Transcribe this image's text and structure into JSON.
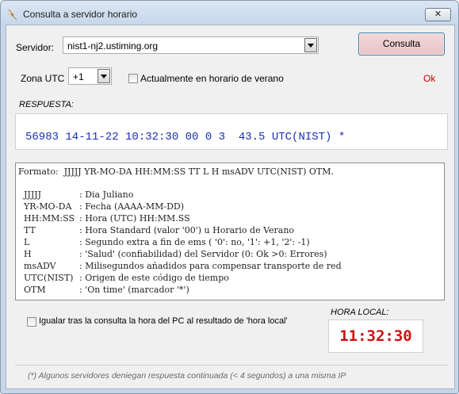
{
  "window": {
    "title": "Consulta a servidor horario",
    "close_glyph": "✕",
    "icon": "lightning-app-icon"
  },
  "server": {
    "label": "Servidor:",
    "value": "nist1-nj2.ustiming.org"
  },
  "query_button": {
    "label": "Consulta"
  },
  "zone": {
    "label": "Zona UTC",
    "value": "+1"
  },
  "summer_time": {
    "label": "Actualmente en horario de verano",
    "checked": false
  },
  "status": {
    "text": "Ok",
    "color": "#cc0000"
  },
  "response": {
    "label": "RESPUESTA:",
    "text": "56983 14-11-22 10:32:30 00 0 3  43.5 UTC(NIST) *",
    "color": "#1a2fb0"
  },
  "format": {
    "header": "Formato:  JJJJJ YR-MO-DA HH:MM:SS TT L H msADV UTC(NIST) OTM.",
    "legend": [
      {
        "key": "JJJJJ",
        "desc": ": Dia Juliano"
      },
      {
        "key": "YR-MO-DA",
        "desc": ": Fecha (AAAA-MM-DD)"
      },
      {
        "key": "HH:MM:SS",
        "desc": ": Hora (UTC) HH:MM.SS"
      },
      {
        "key": "TT",
        "desc": ": Hora Standard (valor '00') u Horario de Verano"
      },
      {
        "key": "L",
        "desc": ": Segundo extra a fin de ems ( '0': no, '1': +1, '2': -1)"
      },
      {
        "key": "H",
        "desc": ": 'Salud' (confiabilidad) del Servidor (0: Ok >0: Errores)"
      },
      {
        "key": "msADV",
        "desc": ": Milisegundos añadidos para compensar transporte de red"
      },
      {
        "key": "UTC(NIST)",
        "desc": ": Origen de este código de tiempo"
      },
      {
        "key": "OTM",
        "desc": ": 'On time' (marcador '*')"
      }
    ]
  },
  "sync_pc": {
    "label": "Igualar tras la consulta la hora del PC al resultado de 'hora local'",
    "checked": false
  },
  "local_time": {
    "label": "HORA LOCAL:",
    "value": "11:32:30",
    "color": "#cc1111"
  },
  "footer": {
    "note": "(*) Algunos servidores deniegan respuesta continuada  (< 4 segundos)  a una misma IP"
  }
}
